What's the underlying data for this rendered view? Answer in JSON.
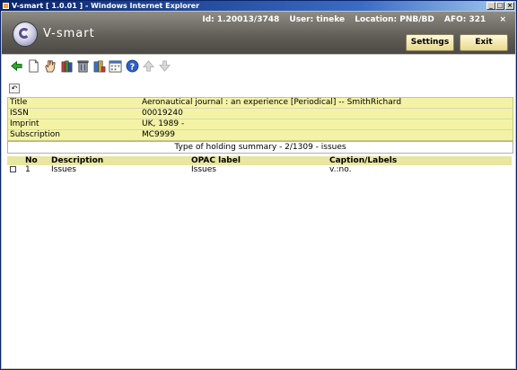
{
  "window": {
    "title": "V-smart [ 1.0.01 ] - Windows Internet Explorer"
  },
  "header": {
    "logo_text": "V-smart",
    "id_text": "Id: 1.20013/3748",
    "user_text": "User: tineke",
    "location_text": "Location: PNB/BD",
    "afo_text": "AFO: 321",
    "close_label": "×",
    "settings_label": "Settings",
    "exit_label": "Exit"
  },
  "toolbar": {
    "icons": [
      "back-arrow-icon",
      "new-document-icon",
      "hand-select-icon",
      "books-icon",
      "trash-icon",
      "book-stack-icon",
      "calendar-icon",
      "help-icon",
      "up-arrow-icon",
      "down-arrow-icon"
    ]
  },
  "record": {
    "title_label": "Title",
    "title_value": "Aeronautical journal : an experience [Periodical] -- SmithRichard",
    "issn_label": "ISSN",
    "issn_value": "00019240",
    "imprint_label": "Imprint",
    "imprint_value": "UK, 1989 -",
    "subscription_label": "Subscription",
    "subscription_value": "MC9999"
  },
  "summary_text": "Type of holding summary - 2/1309 - issues",
  "table": {
    "headers": [
      "No",
      "Description",
      "OPAC label",
      "Caption/Labels"
    ],
    "rows": [
      {
        "no": "1",
        "description": "Issues",
        "opac": "Issues",
        "caption": "v.:no."
      }
    ]
  },
  "colors": {
    "info_bg": "#f4f3a5",
    "button_bg": "#f0e6a8",
    "header_bg": "#5f5c56"
  }
}
